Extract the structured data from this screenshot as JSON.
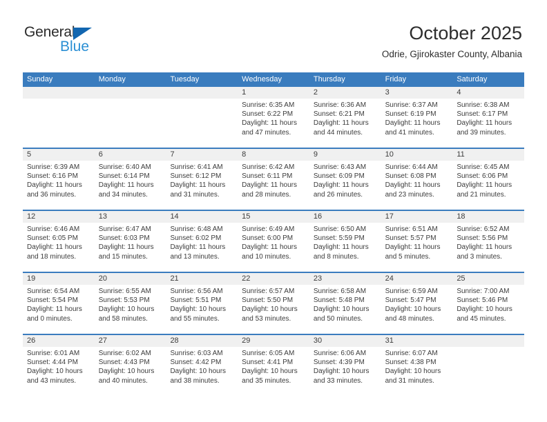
{
  "logo": {
    "word_one": "General",
    "word_two": "Blue",
    "triangle_color": "#1266b0",
    "blue_color": "#2a8fd4"
  },
  "header": {
    "title": "October 2025",
    "subtitle": "Odrie, Gjirokaster County, Albania"
  },
  "calendar": {
    "header_bg": "#3a7cbe",
    "daynum_bg": "#f0f0f0",
    "weekdays": [
      "Sunday",
      "Monday",
      "Tuesday",
      "Wednesday",
      "Thursday",
      "Friday",
      "Saturday"
    ],
    "weeks": [
      [
        {
          "day": "",
          "sunrise": "",
          "sunset": "",
          "daylight_line1": "",
          "daylight_line2": ""
        },
        {
          "day": "",
          "sunrise": "",
          "sunset": "",
          "daylight_line1": "",
          "daylight_line2": ""
        },
        {
          "day": "",
          "sunrise": "",
          "sunset": "",
          "daylight_line1": "",
          "daylight_line2": ""
        },
        {
          "day": "1",
          "sunrise": "Sunrise: 6:35 AM",
          "sunset": "Sunset: 6:22 PM",
          "daylight_line1": "Daylight: 11 hours",
          "daylight_line2": "and 47 minutes."
        },
        {
          "day": "2",
          "sunrise": "Sunrise: 6:36 AM",
          "sunset": "Sunset: 6:21 PM",
          "daylight_line1": "Daylight: 11 hours",
          "daylight_line2": "and 44 minutes."
        },
        {
          "day": "3",
          "sunrise": "Sunrise: 6:37 AM",
          "sunset": "Sunset: 6:19 PM",
          "daylight_line1": "Daylight: 11 hours",
          "daylight_line2": "and 41 minutes."
        },
        {
          "day": "4",
          "sunrise": "Sunrise: 6:38 AM",
          "sunset": "Sunset: 6:17 PM",
          "daylight_line1": "Daylight: 11 hours",
          "daylight_line2": "and 39 minutes."
        }
      ],
      [
        {
          "day": "5",
          "sunrise": "Sunrise: 6:39 AM",
          "sunset": "Sunset: 6:16 PM",
          "daylight_line1": "Daylight: 11 hours",
          "daylight_line2": "and 36 minutes."
        },
        {
          "day": "6",
          "sunrise": "Sunrise: 6:40 AM",
          "sunset": "Sunset: 6:14 PM",
          "daylight_line1": "Daylight: 11 hours",
          "daylight_line2": "and 34 minutes."
        },
        {
          "day": "7",
          "sunrise": "Sunrise: 6:41 AM",
          "sunset": "Sunset: 6:12 PM",
          "daylight_line1": "Daylight: 11 hours",
          "daylight_line2": "and 31 minutes."
        },
        {
          "day": "8",
          "sunrise": "Sunrise: 6:42 AM",
          "sunset": "Sunset: 6:11 PM",
          "daylight_line1": "Daylight: 11 hours",
          "daylight_line2": "and 28 minutes."
        },
        {
          "day": "9",
          "sunrise": "Sunrise: 6:43 AM",
          "sunset": "Sunset: 6:09 PM",
          "daylight_line1": "Daylight: 11 hours",
          "daylight_line2": "and 26 minutes."
        },
        {
          "day": "10",
          "sunrise": "Sunrise: 6:44 AM",
          "sunset": "Sunset: 6:08 PM",
          "daylight_line1": "Daylight: 11 hours",
          "daylight_line2": "and 23 minutes."
        },
        {
          "day": "11",
          "sunrise": "Sunrise: 6:45 AM",
          "sunset": "Sunset: 6:06 PM",
          "daylight_line1": "Daylight: 11 hours",
          "daylight_line2": "and 21 minutes."
        }
      ],
      [
        {
          "day": "12",
          "sunrise": "Sunrise: 6:46 AM",
          "sunset": "Sunset: 6:05 PM",
          "daylight_line1": "Daylight: 11 hours",
          "daylight_line2": "and 18 minutes."
        },
        {
          "day": "13",
          "sunrise": "Sunrise: 6:47 AM",
          "sunset": "Sunset: 6:03 PM",
          "daylight_line1": "Daylight: 11 hours",
          "daylight_line2": "and 15 minutes."
        },
        {
          "day": "14",
          "sunrise": "Sunrise: 6:48 AM",
          "sunset": "Sunset: 6:02 PM",
          "daylight_line1": "Daylight: 11 hours",
          "daylight_line2": "and 13 minutes."
        },
        {
          "day": "15",
          "sunrise": "Sunrise: 6:49 AM",
          "sunset": "Sunset: 6:00 PM",
          "daylight_line1": "Daylight: 11 hours",
          "daylight_line2": "and 10 minutes."
        },
        {
          "day": "16",
          "sunrise": "Sunrise: 6:50 AM",
          "sunset": "Sunset: 5:59 PM",
          "daylight_line1": "Daylight: 11 hours",
          "daylight_line2": "and 8 minutes."
        },
        {
          "day": "17",
          "sunrise": "Sunrise: 6:51 AM",
          "sunset": "Sunset: 5:57 PM",
          "daylight_line1": "Daylight: 11 hours",
          "daylight_line2": "and 5 minutes."
        },
        {
          "day": "18",
          "sunrise": "Sunrise: 6:52 AM",
          "sunset": "Sunset: 5:56 PM",
          "daylight_line1": "Daylight: 11 hours",
          "daylight_line2": "and 3 minutes."
        }
      ],
      [
        {
          "day": "19",
          "sunrise": "Sunrise: 6:54 AM",
          "sunset": "Sunset: 5:54 PM",
          "daylight_line1": "Daylight: 11 hours",
          "daylight_line2": "and 0 minutes."
        },
        {
          "day": "20",
          "sunrise": "Sunrise: 6:55 AM",
          "sunset": "Sunset: 5:53 PM",
          "daylight_line1": "Daylight: 10 hours",
          "daylight_line2": "and 58 minutes."
        },
        {
          "day": "21",
          "sunrise": "Sunrise: 6:56 AM",
          "sunset": "Sunset: 5:51 PM",
          "daylight_line1": "Daylight: 10 hours",
          "daylight_line2": "and 55 minutes."
        },
        {
          "day": "22",
          "sunrise": "Sunrise: 6:57 AM",
          "sunset": "Sunset: 5:50 PM",
          "daylight_line1": "Daylight: 10 hours",
          "daylight_line2": "and 53 minutes."
        },
        {
          "day": "23",
          "sunrise": "Sunrise: 6:58 AM",
          "sunset": "Sunset: 5:48 PM",
          "daylight_line1": "Daylight: 10 hours",
          "daylight_line2": "and 50 minutes."
        },
        {
          "day": "24",
          "sunrise": "Sunrise: 6:59 AM",
          "sunset": "Sunset: 5:47 PM",
          "daylight_line1": "Daylight: 10 hours",
          "daylight_line2": "and 48 minutes."
        },
        {
          "day": "25",
          "sunrise": "Sunrise: 7:00 AM",
          "sunset": "Sunset: 5:46 PM",
          "daylight_line1": "Daylight: 10 hours",
          "daylight_line2": "and 45 minutes."
        }
      ],
      [
        {
          "day": "26",
          "sunrise": "Sunrise: 6:01 AM",
          "sunset": "Sunset: 4:44 PM",
          "daylight_line1": "Daylight: 10 hours",
          "daylight_line2": "and 43 minutes."
        },
        {
          "day": "27",
          "sunrise": "Sunrise: 6:02 AM",
          "sunset": "Sunset: 4:43 PM",
          "daylight_line1": "Daylight: 10 hours",
          "daylight_line2": "and 40 minutes."
        },
        {
          "day": "28",
          "sunrise": "Sunrise: 6:03 AM",
          "sunset": "Sunset: 4:42 PM",
          "daylight_line1": "Daylight: 10 hours",
          "daylight_line2": "and 38 minutes."
        },
        {
          "day": "29",
          "sunrise": "Sunrise: 6:05 AM",
          "sunset": "Sunset: 4:41 PM",
          "daylight_line1": "Daylight: 10 hours",
          "daylight_line2": "and 35 minutes."
        },
        {
          "day": "30",
          "sunrise": "Sunrise: 6:06 AM",
          "sunset": "Sunset: 4:39 PM",
          "daylight_line1": "Daylight: 10 hours",
          "daylight_line2": "and 33 minutes."
        },
        {
          "day": "31",
          "sunrise": "Sunrise: 6:07 AM",
          "sunset": "Sunset: 4:38 PM",
          "daylight_line1": "Daylight: 10 hours",
          "daylight_line2": "and 31 minutes."
        },
        {
          "day": "",
          "sunrise": "",
          "sunset": "",
          "daylight_line1": "",
          "daylight_line2": ""
        }
      ]
    ]
  }
}
